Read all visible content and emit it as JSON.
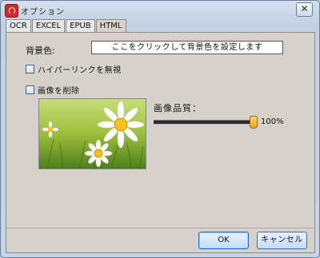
{
  "window": {
    "title": "オプション",
    "close_glyph": "✕"
  },
  "tabs": [
    {
      "label": "OCR",
      "active": false
    },
    {
      "label": "EXCEL",
      "active": false
    },
    {
      "label": "EPUB",
      "active": false
    },
    {
      "label": "HTML",
      "active": true
    }
  ],
  "html_tab": {
    "background_label": "背景色:",
    "background_button": "ここをクリックして背景色を設定します",
    "ignore_hyperlinks": {
      "label": "ハイパーリンクを無視",
      "checked": false
    },
    "remove_images": {
      "label": "画像を削除",
      "checked": false
    },
    "image_quality_label": "画像品質：",
    "image_quality_value": 100,
    "image_quality_text": "100%",
    "preview_description": "daisy-flowers-image"
  },
  "footer": {
    "ok_label": "OK",
    "cancel_label": "キャンセル"
  },
  "colors": {
    "accent": "#3d6ea8",
    "slider_thumb": "#f0a012",
    "panel": "#d6d2cb"
  }
}
